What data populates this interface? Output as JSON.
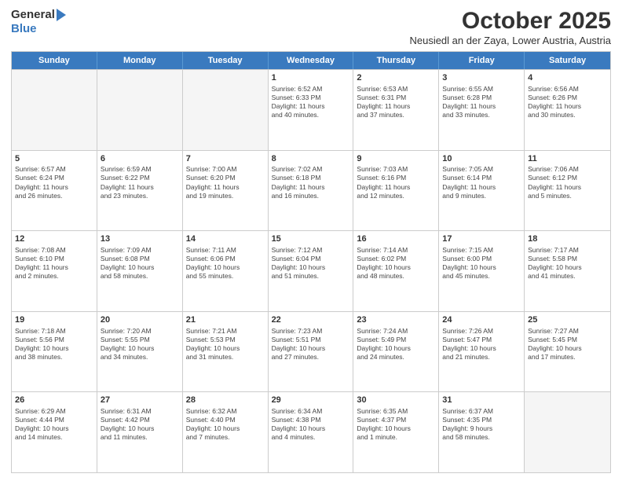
{
  "logo": {
    "general": "General",
    "blue": "Blue"
  },
  "header": {
    "month": "October 2025",
    "subtitle": "Neusiedl an der Zaya, Lower Austria, Austria"
  },
  "weekdays": [
    "Sunday",
    "Monday",
    "Tuesday",
    "Wednesday",
    "Thursday",
    "Friday",
    "Saturday"
  ],
  "weeks": [
    [
      {
        "day": "",
        "info": "",
        "empty": true
      },
      {
        "day": "",
        "info": "",
        "empty": true
      },
      {
        "day": "",
        "info": "",
        "empty": true
      },
      {
        "day": "1",
        "info": "Sunrise: 6:52 AM\nSunset: 6:33 PM\nDaylight: 11 hours\nand 40 minutes.",
        "empty": false
      },
      {
        "day": "2",
        "info": "Sunrise: 6:53 AM\nSunset: 6:31 PM\nDaylight: 11 hours\nand 37 minutes.",
        "empty": false
      },
      {
        "day": "3",
        "info": "Sunrise: 6:55 AM\nSunset: 6:28 PM\nDaylight: 11 hours\nand 33 minutes.",
        "empty": false
      },
      {
        "day": "4",
        "info": "Sunrise: 6:56 AM\nSunset: 6:26 PM\nDaylight: 11 hours\nand 30 minutes.",
        "empty": false
      }
    ],
    [
      {
        "day": "5",
        "info": "Sunrise: 6:57 AM\nSunset: 6:24 PM\nDaylight: 11 hours\nand 26 minutes.",
        "empty": false
      },
      {
        "day": "6",
        "info": "Sunrise: 6:59 AM\nSunset: 6:22 PM\nDaylight: 11 hours\nand 23 minutes.",
        "empty": false
      },
      {
        "day": "7",
        "info": "Sunrise: 7:00 AM\nSunset: 6:20 PM\nDaylight: 11 hours\nand 19 minutes.",
        "empty": false
      },
      {
        "day": "8",
        "info": "Sunrise: 7:02 AM\nSunset: 6:18 PM\nDaylight: 11 hours\nand 16 minutes.",
        "empty": false
      },
      {
        "day": "9",
        "info": "Sunrise: 7:03 AM\nSunset: 6:16 PM\nDaylight: 11 hours\nand 12 minutes.",
        "empty": false
      },
      {
        "day": "10",
        "info": "Sunrise: 7:05 AM\nSunset: 6:14 PM\nDaylight: 11 hours\nand 9 minutes.",
        "empty": false
      },
      {
        "day": "11",
        "info": "Sunrise: 7:06 AM\nSunset: 6:12 PM\nDaylight: 11 hours\nand 5 minutes.",
        "empty": false
      }
    ],
    [
      {
        "day": "12",
        "info": "Sunrise: 7:08 AM\nSunset: 6:10 PM\nDaylight: 11 hours\nand 2 minutes.",
        "empty": false
      },
      {
        "day": "13",
        "info": "Sunrise: 7:09 AM\nSunset: 6:08 PM\nDaylight: 10 hours\nand 58 minutes.",
        "empty": false
      },
      {
        "day": "14",
        "info": "Sunrise: 7:11 AM\nSunset: 6:06 PM\nDaylight: 10 hours\nand 55 minutes.",
        "empty": false
      },
      {
        "day": "15",
        "info": "Sunrise: 7:12 AM\nSunset: 6:04 PM\nDaylight: 10 hours\nand 51 minutes.",
        "empty": false
      },
      {
        "day": "16",
        "info": "Sunrise: 7:14 AM\nSunset: 6:02 PM\nDaylight: 10 hours\nand 48 minutes.",
        "empty": false
      },
      {
        "day": "17",
        "info": "Sunrise: 7:15 AM\nSunset: 6:00 PM\nDaylight: 10 hours\nand 45 minutes.",
        "empty": false
      },
      {
        "day": "18",
        "info": "Sunrise: 7:17 AM\nSunset: 5:58 PM\nDaylight: 10 hours\nand 41 minutes.",
        "empty": false
      }
    ],
    [
      {
        "day": "19",
        "info": "Sunrise: 7:18 AM\nSunset: 5:56 PM\nDaylight: 10 hours\nand 38 minutes.",
        "empty": false
      },
      {
        "day": "20",
        "info": "Sunrise: 7:20 AM\nSunset: 5:55 PM\nDaylight: 10 hours\nand 34 minutes.",
        "empty": false
      },
      {
        "day": "21",
        "info": "Sunrise: 7:21 AM\nSunset: 5:53 PM\nDaylight: 10 hours\nand 31 minutes.",
        "empty": false
      },
      {
        "day": "22",
        "info": "Sunrise: 7:23 AM\nSunset: 5:51 PM\nDaylight: 10 hours\nand 27 minutes.",
        "empty": false
      },
      {
        "day": "23",
        "info": "Sunrise: 7:24 AM\nSunset: 5:49 PM\nDaylight: 10 hours\nand 24 minutes.",
        "empty": false
      },
      {
        "day": "24",
        "info": "Sunrise: 7:26 AM\nSunset: 5:47 PM\nDaylight: 10 hours\nand 21 minutes.",
        "empty": false
      },
      {
        "day": "25",
        "info": "Sunrise: 7:27 AM\nSunset: 5:45 PM\nDaylight: 10 hours\nand 17 minutes.",
        "empty": false
      }
    ],
    [
      {
        "day": "26",
        "info": "Sunrise: 6:29 AM\nSunset: 4:44 PM\nDaylight: 10 hours\nand 14 minutes.",
        "empty": false
      },
      {
        "day": "27",
        "info": "Sunrise: 6:31 AM\nSunset: 4:42 PM\nDaylight: 10 hours\nand 11 minutes.",
        "empty": false
      },
      {
        "day": "28",
        "info": "Sunrise: 6:32 AM\nSunset: 4:40 PM\nDaylight: 10 hours\nand 7 minutes.",
        "empty": false
      },
      {
        "day": "29",
        "info": "Sunrise: 6:34 AM\nSunset: 4:38 PM\nDaylight: 10 hours\nand 4 minutes.",
        "empty": false
      },
      {
        "day": "30",
        "info": "Sunrise: 6:35 AM\nSunset: 4:37 PM\nDaylight: 10 hours\nand 1 minute.",
        "empty": false
      },
      {
        "day": "31",
        "info": "Sunrise: 6:37 AM\nSunset: 4:35 PM\nDaylight: 9 hours\nand 58 minutes.",
        "empty": false
      },
      {
        "day": "",
        "info": "",
        "empty": true
      }
    ]
  ]
}
